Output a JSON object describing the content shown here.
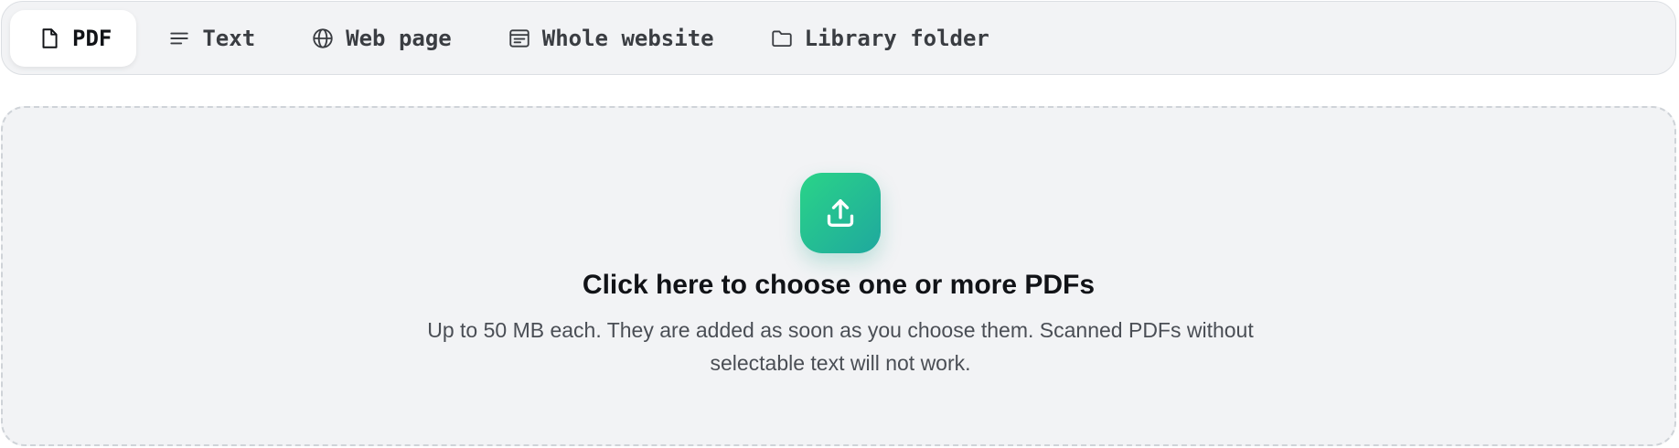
{
  "tabs": [
    {
      "label": "PDF",
      "icon": "file-icon",
      "active": true
    },
    {
      "label": "Text",
      "icon": "text-lines-icon",
      "active": false
    },
    {
      "label": "Web page",
      "icon": "globe-icon",
      "active": false
    },
    {
      "label": "Whole website",
      "icon": "browser-window-icon",
      "active": false
    },
    {
      "label": "Library folder",
      "icon": "folder-icon",
      "active": false
    }
  ],
  "dropzone": {
    "icon": "upload-icon",
    "title": "Click here to choose one or more PDFs",
    "subtitle": "Up to 50 MB each. They are added as soon as you choose them. Scanned PDFs without selectable text will not work."
  },
  "colors": {
    "accent_gradient_start": "#2ad488",
    "accent_gradient_end": "#1fa89e",
    "panel_background": "#f2f3f5"
  }
}
